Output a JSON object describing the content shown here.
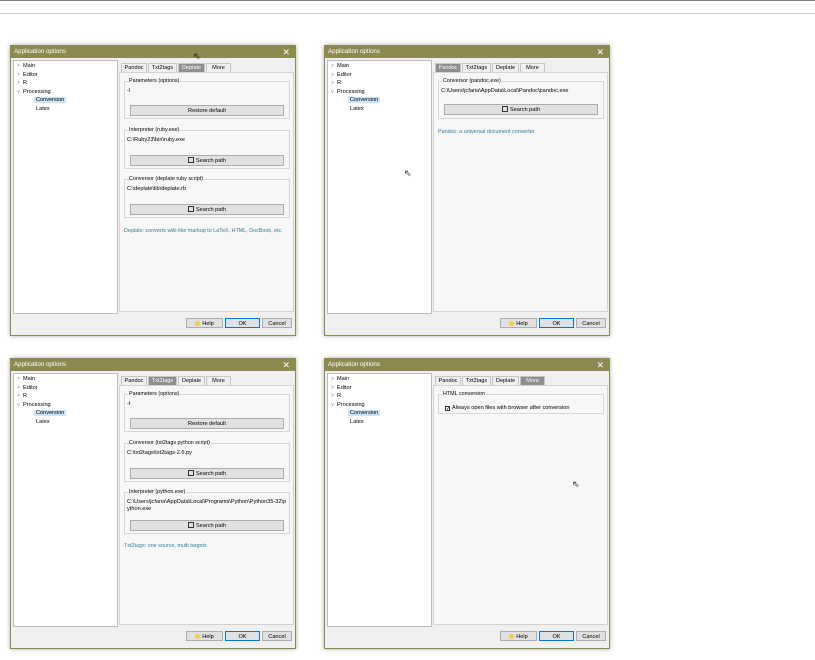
{
  "dialog_title": "Application options",
  "tree": {
    "main": "Main",
    "editor": "Editor",
    "r": "R",
    "processing": "Processing",
    "conversion": "Conversion",
    "latex": "Latex"
  },
  "tabs": {
    "pandoc": "Pandoc",
    "txt2tags": "Txt2tags",
    "deplate": "Deplate",
    "more": "More"
  },
  "buttons": {
    "help": "Help",
    "ok": "OK",
    "cancel": "Cancel",
    "restore_default": "Restore default",
    "search_path": "Search path"
  },
  "deplate": {
    "params_label": "Parameters (options)",
    "params_value": "-l",
    "interpreter_label": "Interpreter (ruby.exe)",
    "interpreter_value": "C:\\Ruby23\\bin\\ruby.exe",
    "conversor_label": "Conversor (deplate ruby script)",
    "conversor_value": "C:\\deplate\\lib\\deplate.rb",
    "description": "Deplate: converts wiki-like markup to LaTeX, HTML, DocBook, etc."
  },
  "pandoc": {
    "conversor_label": "Conversor (pandoc.exe)",
    "conversor_value": "C:\\Users\\jcfaria\\AppData\\Local\\Pandoc\\pandoc.exe",
    "description": "Pandoc: a universal document converter"
  },
  "txt2tags": {
    "params_label": "Parameters (options)",
    "params_value": "-t",
    "conversor_label": "Conversor (txt2tags python script)",
    "conversor_value": "C:\\txt2tags\\txt2tags-2.6.py",
    "interpreter_label": "Interpreter (python.exe)",
    "interpreter_value": "C:\\Users\\jcfaria\\AppData\\Local\\Programs\\Python\\Python35-32\\python.exe",
    "description": "Txt2tags: one source, multi targets"
  },
  "more": {
    "group_label": "HTML conversion",
    "checkbox_label": "Always open files with browser after conversion",
    "checkbox_checked": true
  }
}
